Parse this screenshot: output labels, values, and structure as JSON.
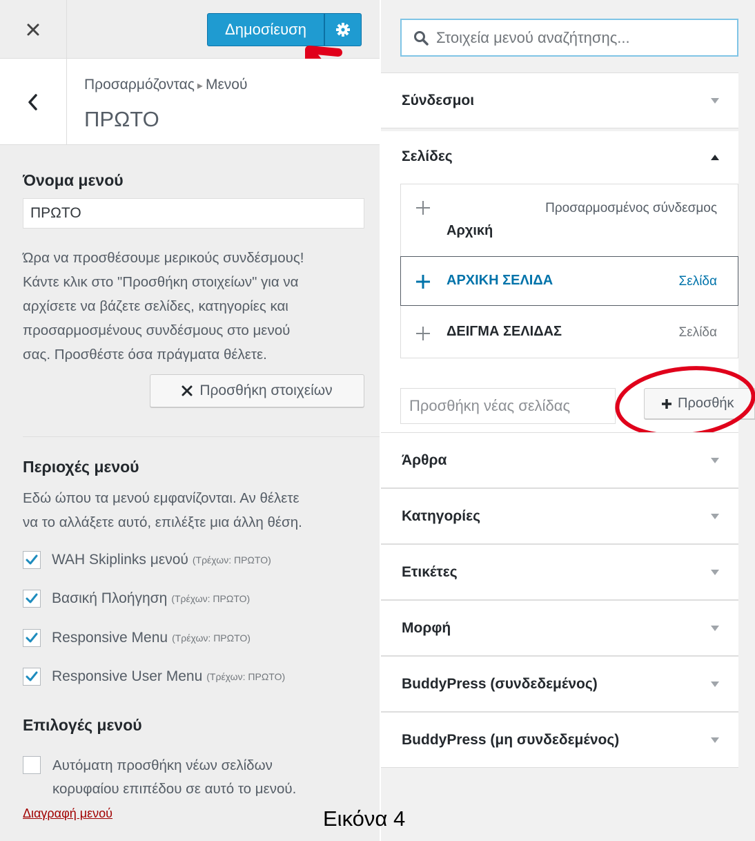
{
  "header": {
    "publish_label": "Δημοσίευση",
    "breadcrumb_root": "Προσαρμόζοντας",
    "breadcrumb_separator": "▸",
    "breadcrumb_current": "Μενού",
    "page_title": "ΠΡΩΤΟ"
  },
  "menu_name": {
    "label": "Όνομα μενού",
    "value": "ΠΡΩΤΟ"
  },
  "intro_lines": [
    "Ώρα να προσθέσουμε μερικούς συνδέσμους!",
    "Κάντε κλικ στο \"Προσθήκη στοιχείων\" για να",
    "αρχίσετε να βάζετε σελίδες, κατηγορίες και",
    "προσαρμοσμένους συνδέσμους στο μενού",
    "σας. Προσθέστε όσα πράγματα θέλετε."
  ],
  "add_items_label": "Προσθήκη στοιχείων",
  "menu_locations": {
    "title": "Περιοχές μενού",
    "desc_lines": [
      "Εδώ ώπου τα μενού εμφανίζονται. Αν θέλετε",
      "να το αλλάξετε αυτό, επιλέξτε μια άλλη θέση."
    ],
    "items": [
      {
        "label": "WAH Skiplinks μενού",
        "current": "(Τρέχων: ΠΡΩΤΟ)",
        "checked": true
      },
      {
        "label": "Βασική Πλοήγηση",
        "current": "(Τρέχων: ΠΡΩΤΟ)",
        "checked": true
      },
      {
        "label": "Responsive Menu",
        "current": "(Τρέχων: ΠΡΩΤΟ)",
        "checked": true
      },
      {
        "label": "Responsive User Menu",
        "current": "(Τρέχων: ΠΡΩΤΟ)",
        "checked": true
      }
    ]
  },
  "menu_options": {
    "title": "Επιλογές μενού",
    "auto_add_lines": [
      "Αυτόματη προσθήκη νέων σελίδων",
      "κορυφαίου επιπέδου σε αυτό το μενού."
    ],
    "auto_add_checked": false
  },
  "delete_menu_label": "Διαγραφή μενού",
  "search": {
    "placeholder": "Στοιχεία μενού αναζήτησης..."
  },
  "accordion": {
    "links": "Σύνδεσμοι",
    "pages": "Σελίδες",
    "posts": "Άρθρα",
    "categories": "Κατηγορίες",
    "tags": "Ετικέτες",
    "format": "Μορφή",
    "bp_logged_in": "BuddyPress (συνδεδεμένος)",
    "bp_logged_out": "BuddyPress (μη συνδεδεμένος)"
  },
  "pages_items": [
    {
      "title": "Αρχική",
      "type": "Προσαρμοσμένος σύνδεσμος"
    },
    {
      "title": "ΑΡΧΙΚΗ ΣΕΛΙΔΑ",
      "type": "Σελίδα"
    },
    {
      "title": "ΔΕΙΓΜΑ ΣΕΛΙΔΑΣ",
      "type": "Σελίδα"
    }
  ],
  "new_page": {
    "placeholder": "Προσθήκη νέας σελίδας",
    "button_label": "Προσθήκ"
  },
  "caption": "Εικόνα 4",
  "colors": {
    "accent_blue": "#1f9bd1",
    "annotation_red": "#e0001b",
    "link_blue": "#0073aa"
  }
}
